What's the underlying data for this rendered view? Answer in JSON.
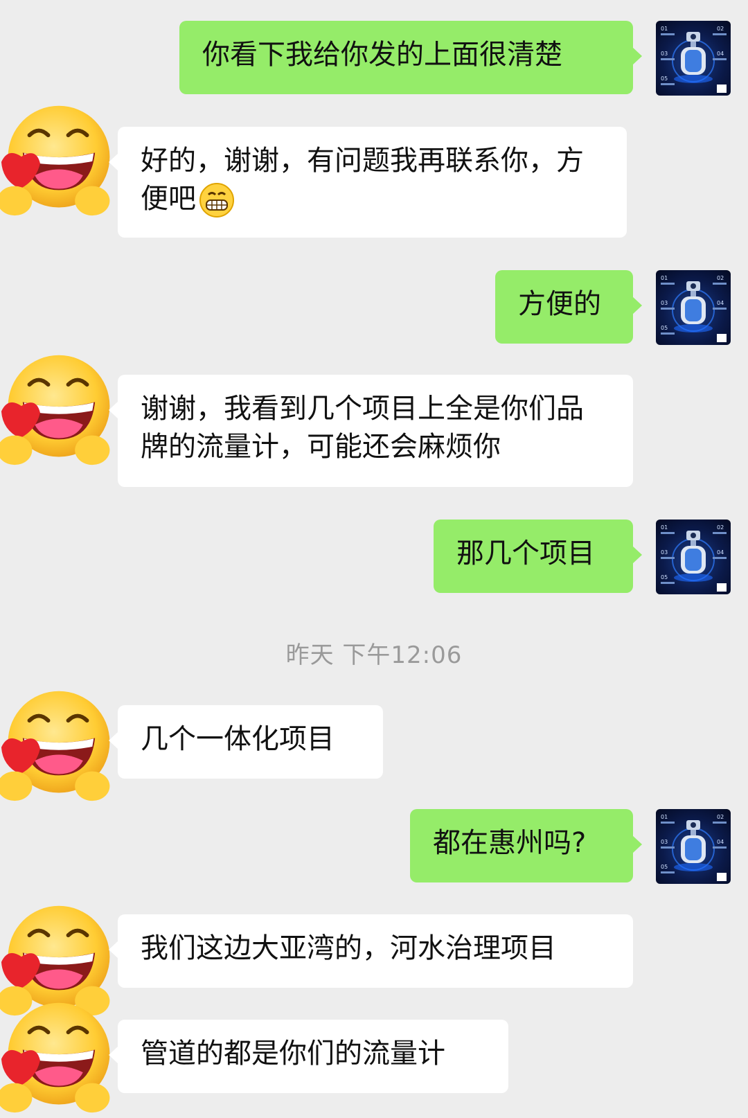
{
  "messages": [
    {
      "from": "me",
      "text": "你看下我给你发的上面很清楚"
    },
    {
      "from": "them",
      "text": "好的，谢谢，有问题我再联系你，方便吧",
      "emoji": "grinning-emoji"
    },
    {
      "from": "me",
      "text": "方便的"
    },
    {
      "from": "them",
      "text": "谢谢，我看到几个项目上全是你们品牌的流量计，可能还会麻烦你"
    },
    {
      "from": "me",
      "text": "那几个项目"
    },
    {
      "from": "them",
      "text": "几个一体化项目"
    },
    {
      "from": "me",
      "text": "都在惠州吗?"
    },
    {
      "from": "them",
      "text": "我们这边大亚湾的，河水治理项目"
    },
    {
      "from": "them",
      "text": "管道的都是你们的流量计"
    }
  ],
  "timestamp": "昨天 下午12:06",
  "avatar_self_labels": [
    "01",
    "02",
    "03",
    "04",
    "05"
  ],
  "colors": {
    "sent_bubble": "#95ec69",
    "received_bubble": "#ffffff",
    "background": "#ededed",
    "timestamp": "#9a9a9a"
  }
}
